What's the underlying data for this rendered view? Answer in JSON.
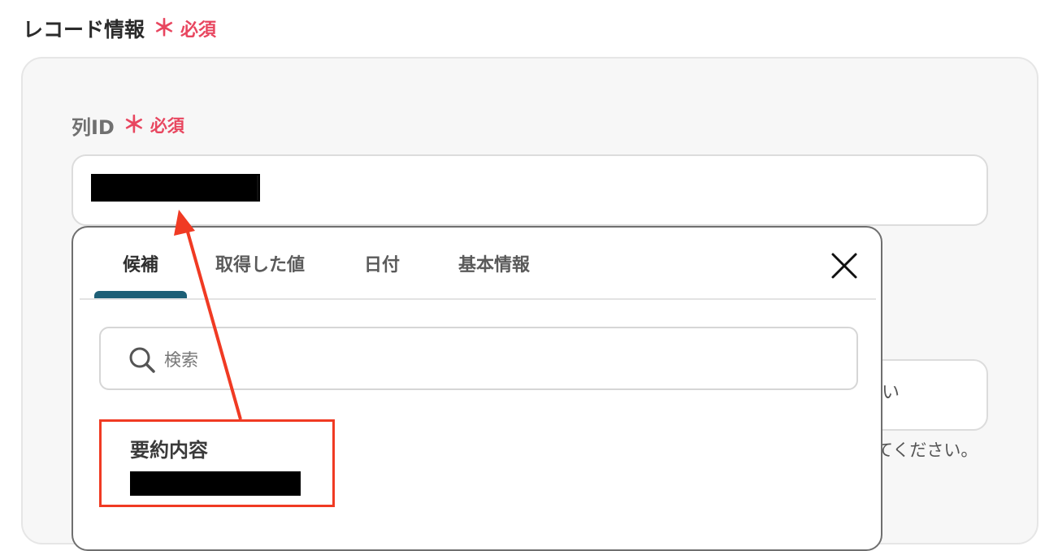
{
  "section": {
    "title": "レコード情報",
    "required_mark": "＊",
    "required_text": "必須"
  },
  "field": {
    "label": "列ID",
    "required_mark": "＊",
    "required_text": "必須",
    "value_redacted": true
  },
  "popup": {
    "tabs": [
      {
        "label": "候補",
        "active": true
      },
      {
        "label": "取得した値",
        "active": false
      },
      {
        "label": "日付",
        "active": false
      },
      {
        "label": "基本情報",
        "active": false
      }
    ],
    "search": {
      "placeholder": "検索",
      "value": ""
    },
    "items": [
      {
        "title": "要約内容",
        "value_redacted": true
      }
    ],
    "close_icon": "close-icon"
  },
  "background": {
    "input_partial_text": "い",
    "hint_partial_text": "てください。"
  },
  "colors": {
    "required": "#e8465f",
    "tab_underline": "#1d5f76",
    "annotation": "#f03a23"
  }
}
